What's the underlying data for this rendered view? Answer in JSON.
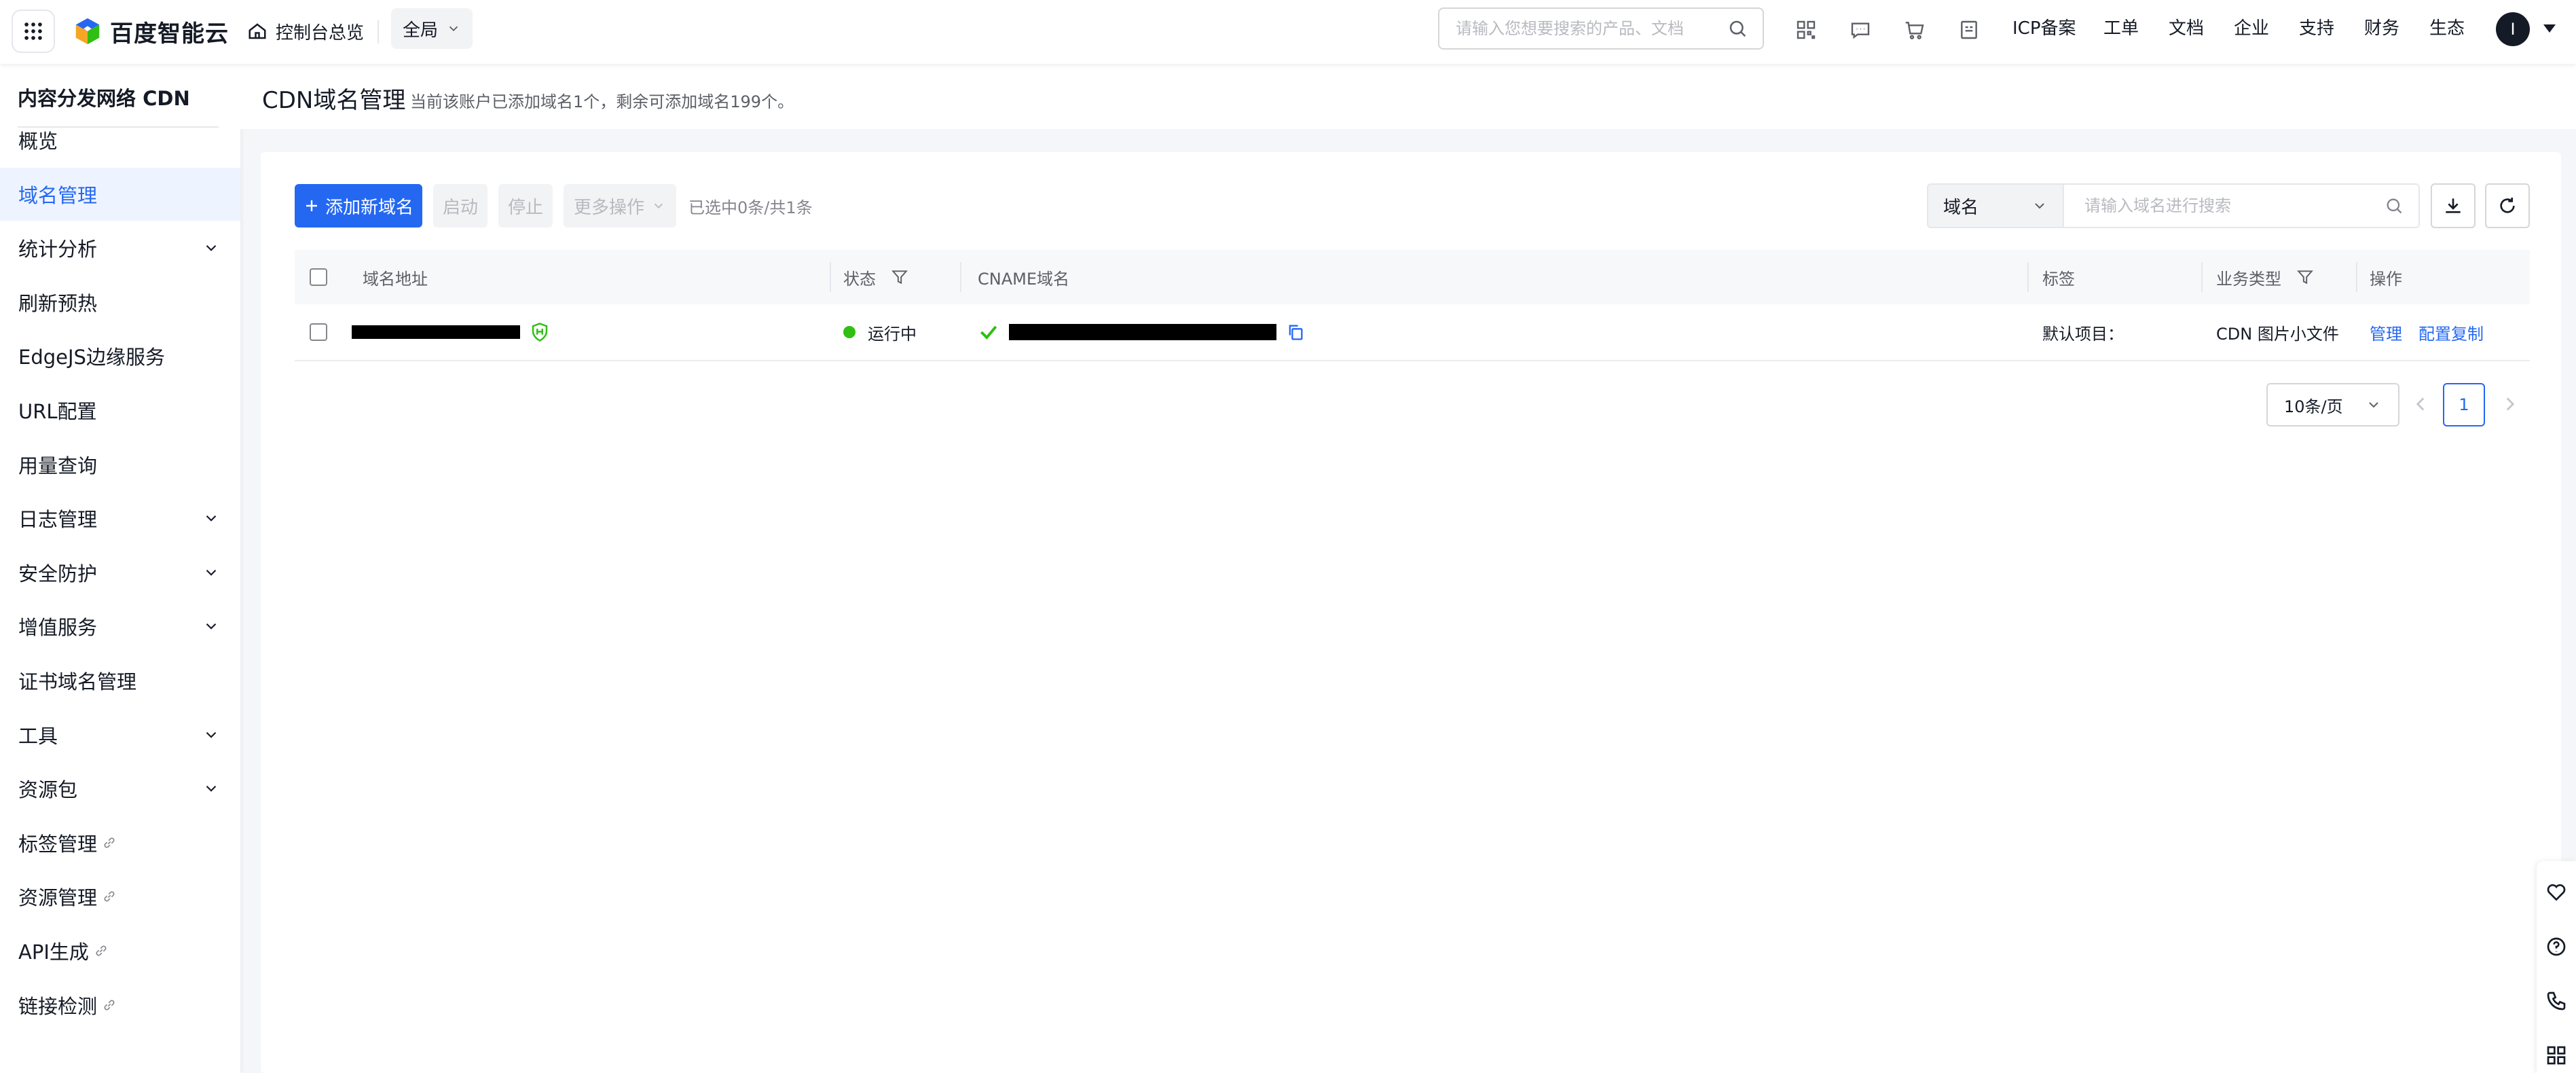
{
  "topnav": {
    "logo_text": "百度智能云",
    "console_home": "控制台总览",
    "region": "全局",
    "search_placeholder": "请输入您想要搜索的产品、文档",
    "links": [
      "ICP备案",
      "工单",
      "文档",
      "企业",
      "支持",
      "财务",
      "生态"
    ],
    "icons": [
      "qrcode-icon",
      "message-icon",
      "cart-icon",
      "document-icon"
    ],
    "avatar_initial": "I"
  },
  "sidebar": {
    "title": "内容分发网络 CDN",
    "items": [
      {
        "label": "概览",
        "active": false,
        "expand": false,
        "external": false
      },
      {
        "label": "域名管理",
        "active": true,
        "expand": false,
        "external": false
      },
      {
        "label": "统计分析",
        "active": false,
        "expand": true,
        "external": false
      },
      {
        "label": "刷新预热",
        "active": false,
        "expand": false,
        "external": false
      },
      {
        "label": "EdgeJS边缘服务",
        "active": false,
        "expand": false,
        "external": false
      },
      {
        "label": "URL配置",
        "active": false,
        "expand": false,
        "external": false
      },
      {
        "label": "用量查询",
        "active": false,
        "expand": false,
        "external": false
      },
      {
        "label": "日志管理",
        "active": false,
        "expand": true,
        "external": false
      },
      {
        "label": "安全防护",
        "active": false,
        "expand": true,
        "external": false
      },
      {
        "label": "增值服务",
        "active": false,
        "expand": true,
        "external": false
      },
      {
        "label": "证书域名管理",
        "active": false,
        "expand": false,
        "external": false
      },
      {
        "label": "工具",
        "active": false,
        "expand": true,
        "external": false
      },
      {
        "label": "资源包",
        "active": false,
        "expand": true,
        "external": false
      },
      {
        "label": "标签管理",
        "active": false,
        "expand": false,
        "external": true
      },
      {
        "label": "资源管理",
        "active": false,
        "expand": false,
        "external": true
      },
      {
        "label": "API生成",
        "active": false,
        "expand": false,
        "external": true
      },
      {
        "label": "链接检测",
        "active": false,
        "expand": false,
        "external": true
      }
    ]
  },
  "page": {
    "title": "CDN域名管理",
    "subtitle": "当前该账户已添加域名1个，剩余可添加域名199个。"
  },
  "toolbar": {
    "add_label": "添加新域名",
    "start_label": "启动",
    "stop_label": "停止",
    "more_label": "更多操作",
    "selected_text": "已选中0条/共1条",
    "search_type": "域名",
    "search_placeholder": "请输入域名进行搜索"
  },
  "table": {
    "headers": {
      "domain": "域名地址",
      "status": "状态",
      "cname": "CNAME域名",
      "tag": "标签",
      "biz_type": "业务类型",
      "action": "操作"
    },
    "rows": [
      {
        "status": "运行中",
        "tag": "默认项目：",
        "biz_type": "CDN 图片小文件",
        "action_manage": "管理",
        "action_copy": "配置复制"
      }
    ]
  },
  "pagination": {
    "page_size": "10条/页",
    "current_page": "1"
  },
  "colors": {
    "primary": "#2468f2",
    "status_running": "#30bf13",
    "shield": "#30bf13"
  }
}
